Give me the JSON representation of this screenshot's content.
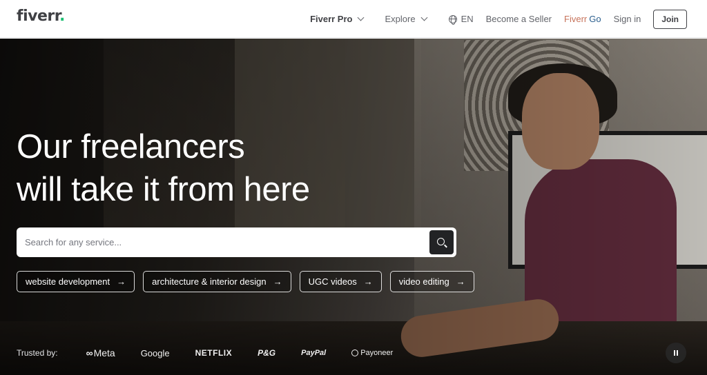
{
  "header": {
    "logo_text": "fiverr",
    "logo_dot": ".",
    "nav": {
      "fiverr_pro": "Fiverr Pro",
      "explore": "Explore",
      "language": "EN",
      "become_seller": "Become a Seller",
      "fiverr_go_a": "Fiverr",
      "fiverr_go_b": "Go",
      "sign_in": "Sign in",
      "join": "Join"
    }
  },
  "hero": {
    "headline_line1": "Our freelancers",
    "headline_line2": "will take it from here",
    "search": {
      "placeholder": "Search for any service..."
    },
    "chips": [
      "website development",
      "architecture & interior design",
      "UGC videos",
      "video editing"
    ],
    "trusted_by": {
      "label": "Trusted by:",
      "brands": [
        "Meta",
        "Google",
        "NETFLIX",
        "P&G",
        "PayPal",
        "Payoneer"
      ]
    }
  },
  "colors": {
    "brand_green": "#1dbf73",
    "text_dark": "#404145",
    "fiverr_go_a": "#c7735b",
    "fiverr_go_b": "#2b5f8e"
  },
  "icons": [
    "chevron-down-icon",
    "globe-icon",
    "search-icon",
    "arrow-right-icon",
    "pause-icon",
    "meta-logo-icon",
    "payoneer-logo-icon"
  ]
}
